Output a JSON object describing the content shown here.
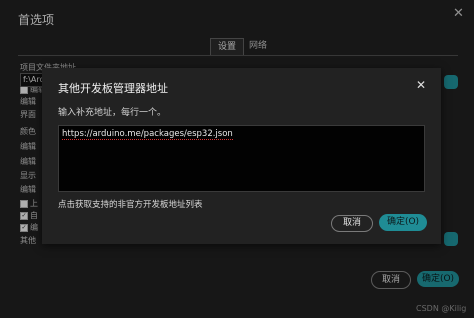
{
  "preferences": {
    "title": "首选项",
    "close_glyph": "✕",
    "tabs": [
      {
        "label": "设置",
        "active": true
      },
      {
        "label": "网络",
        "active": false
      }
    ],
    "background_labels": [
      "项目文件夹地址",
      "编辑",
      "界面",
      "颜色",
      "编辑",
      "编辑",
      "显示",
      "编辑",
      "上",
      "自",
      "编",
      "其他"
    ],
    "sketchbook_path_partial": "f:\\Arc",
    "cancel_label": "取消",
    "ok_label": "确定(O)"
  },
  "dialog": {
    "title": "其他开发板管理器地址",
    "close_glyph": "✕",
    "hint": "输入补充地址，每行一个。",
    "urls": "https://arduino.me/packages/esp32.json",
    "link_text": "点击获取支持的非官方开发板地址列表",
    "cancel_label": "取消",
    "ok_label": "确定(O)"
  },
  "watermark": "CSDN @Kilig",
  "colors": {
    "accent": "#1f8c95",
    "window_bg": "#1f1f1f",
    "dialog_bg": "#222222",
    "textarea_bg": "#020202"
  }
}
